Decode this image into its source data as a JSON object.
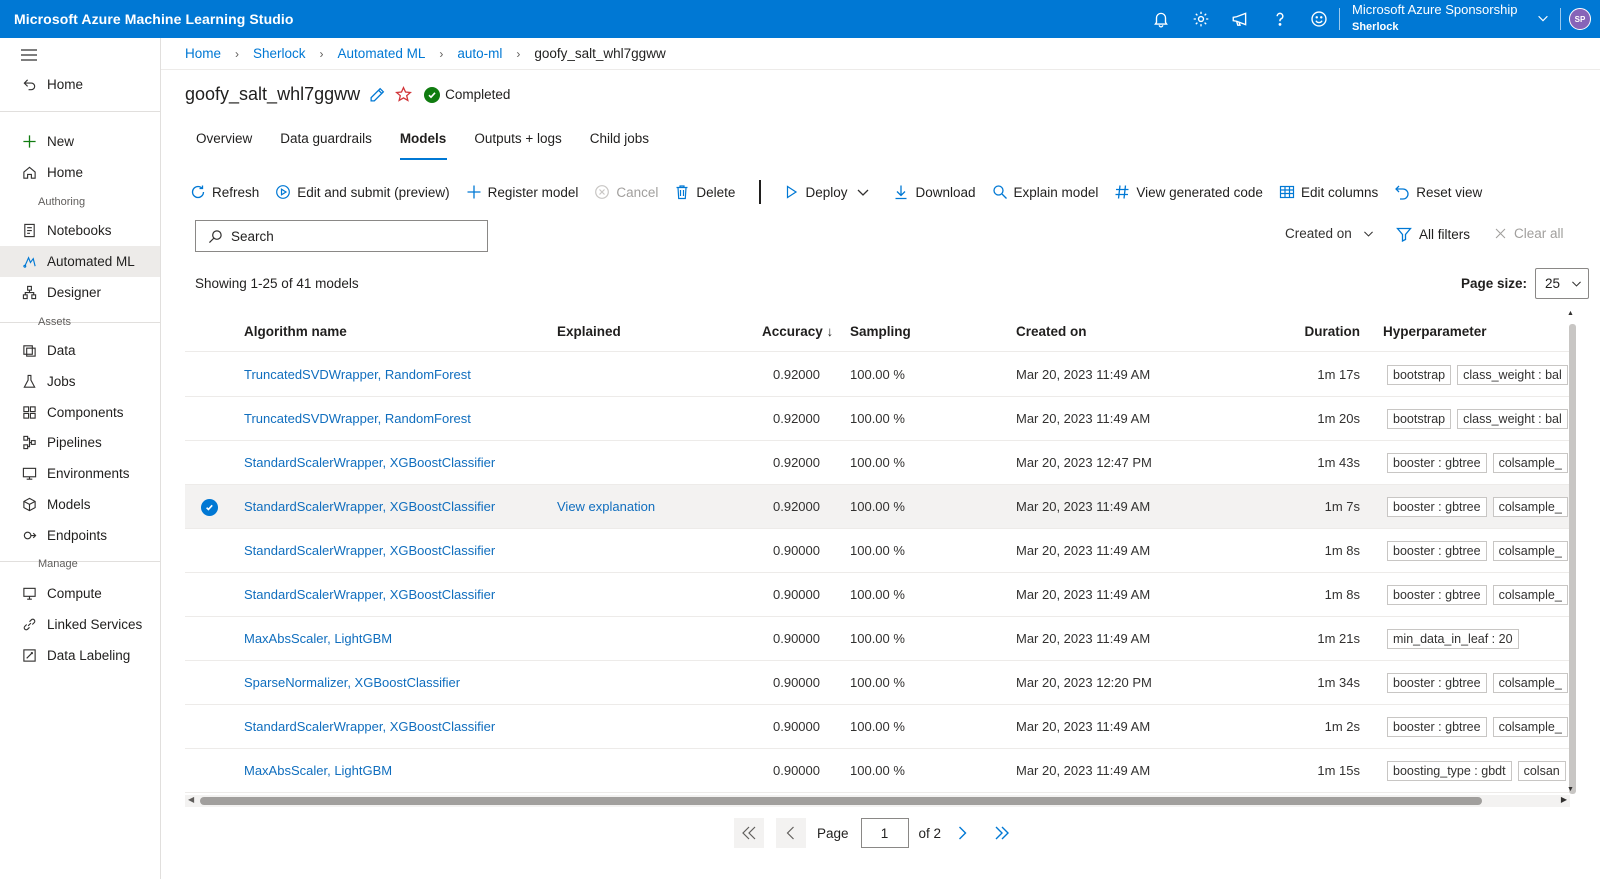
{
  "app": {
    "title": "Microsoft Azure Machine Learning Studio"
  },
  "account": {
    "subscription": "Microsoft Azure Sponsorship",
    "workspace": "Sherlock",
    "initials": "SP"
  },
  "sidebar": {
    "home_top": "Home",
    "new": "New",
    "home": "Home",
    "section_authoring": "Authoring",
    "notebooks": "Notebooks",
    "automated_ml": "Automated ML",
    "designer": "Designer",
    "section_assets": "Assets",
    "data": "Data",
    "jobs": "Jobs",
    "components": "Components",
    "pipelines": "Pipelines",
    "environments": "Environments",
    "models": "Models",
    "endpoints": "Endpoints",
    "section_manage": "Manage",
    "compute": "Compute",
    "linked_services": "Linked Services",
    "data_labeling": "Data Labeling"
  },
  "breadcrumb": [
    "Home",
    "Sherlock",
    "Automated ML",
    "auto-ml",
    "goofy_salt_whl7ggww"
  ],
  "job": {
    "name": "goofy_salt_whl7ggww",
    "status": "Completed",
    "status_color": "#107c10"
  },
  "tabs": [
    "Overview",
    "Data guardrails",
    "Models",
    "Outputs + logs",
    "Child jobs"
  ],
  "toolbar": {
    "refresh": "Refresh",
    "edit_submit": "Edit and submit (preview)",
    "register": "Register model",
    "cancel": "Cancel",
    "delete": "Delete",
    "deploy": "Deploy",
    "download": "Download",
    "explain": "Explain model",
    "view_code": "View generated code",
    "edit_columns": "Edit columns",
    "reset_view": "Reset view"
  },
  "search": {
    "placeholder": "Search"
  },
  "filters": {
    "created_on": "Created on",
    "all_filters": "All filters",
    "clear_all": "Clear all"
  },
  "summary": {
    "showing": "Showing 1-25 of 41 models"
  },
  "page_size": {
    "label": "Page size:",
    "value": "25"
  },
  "table": {
    "headers": {
      "algorithm": "Algorithm name",
      "explained": "Explained",
      "accuracy": "Accuracy ↓",
      "sampling": "Sampling",
      "created": "Created on",
      "duration": "Duration",
      "hyper": "Hyperparameter"
    },
    "rows": [
      {
        "algorithm": "TruncatedSVDWrapper, RandomForest",
        "explained": "",
        "accuracy": "0.92000",
        "sampling": "100.00 %",
        "created": "Mar 20, 2023 11:49 AM",
        "duration": "1m 17s",
        "tags": [
          "bootstrap",
          "class_weight : bal"
        ]
      },
      {
        "algorithm": "TruncatedSVDWrapper, RandomForest",
        "explained": "",
        "accuracy": "0.92000",
        "sampling": "100.00 %",
        "created": "Mar 20, 2023 11:49 AM",
        "duration": "1m 20s",
        "tags": [
          "bootstrap",
          "class_weight : bal"
        ]
      },
      {
        "algorithm": "StandardScalerWrapper, XGBoostClassifier",
        "explained": "",
        "accuracy": "0.92000",
        "sampling": "100.00 %",
        "created": "Mar 20, 2023 12:47 PM",
        "duration": "1m 43s",
        "tags": [
          "booster : gbtree",
          "colsample_"
        ]
      },
      {
        "algorithm": "StandardScalerWrapper, XGBoostClassifier",
        "explained": "View explanation",
        "accuracy": "0.92000",
        "sampling": "100.00 %",
        "created": "Mar 20, 2023 11:49 AM",
        "duration": "1m 7s",
        "tags": [
          "booster : gbtree",
          "colsample_"
        ],
        "selected": true
      },
      {
        "algorithm": "StandardScalerWrapper, XGBoostClassifier",
        "explained": "",
        "accuracy": "0.90000",
        "sampling": "100.00 %",
        "created": "Mar 20, 2023 11:49 AM",
        "duration": "1m 8s",
        "tags": [
          "booster : gbtree",
          "colsample_"
        ]
      },
      {
        "algorithm": "StandardScalerWrapper, XGBoostClassifier",
        "explained": "",
        "accuracy": "0.90000",
        "sampling": "100.00 %",
        "created": "Mar 20, 2023 11:49 AM",
        "duration": "1m 8s",
        "tags": [
          "booster : gbtree",
          "colsample_"
        ]
      },
      {
        "algorithm": "MaxAbsScaler, LightGBM",
        "explained": "",
        "accuracy": "0.90000",
        "sampling": "100.00 %",
        "created": "Mar 20, 2023 11:49 AM",
        "duration": "1m 21s",
        "tags": [
          "min_data_in_leaf : 20"
        ]
      },
      {
        "algorithm": "SparseNormalizer, XGBoostClassifier",
        "explained": "",
        "accuracy": "0.90000",
        "sampling": "100.00 %",
        "created": "Mar 20, 2023 12:20 PM",
        "duration": "1m 34s",
        "tags": [
          "booster : gbtree",
          "colsample_"
        ]
      },
      {
        "algorithm": "StandardScalerWrapper, XGBoostClassifier",
        "explained": "",
        "accuracy": "0.90000",
        "sampling": "100.00 %",
        "created": "Mar 20, 2023 11:49 AM",
        "duration": "1m 2s",
        "tags": [
          "booster : gbtree",
          "colsample_"
        ]
      },
      {
        "algorithm": "MaxAbsScaler, LightGBM",
        "explained": "",
        "accuracy": "0.90000",
        "sampling": "100.00 %",
        "created": "Mar 20, 2023 11:49 AM",
        "duration": "1m 15s",
        "tags": [
          "boosting_type : gbdt",
          "colsan"
        ]
      }
    ]
  },
  "pagination": {
    "page_label": "Page",
    "current": "1",
    "of": "of 2"
  }
}
